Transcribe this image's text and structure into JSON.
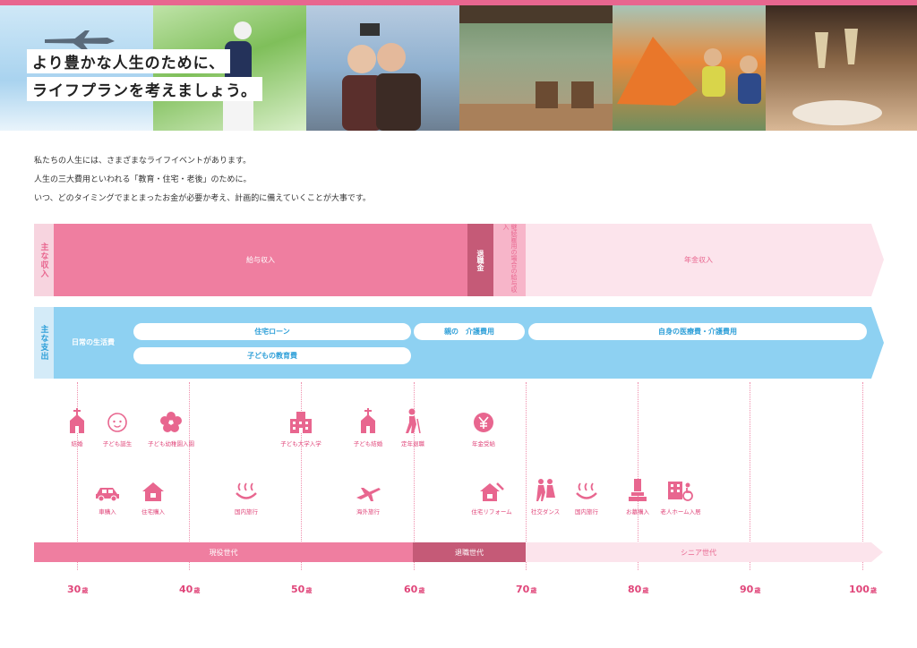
{
  "headline": {
    "line1": "より豊かな人生のために、",
    "line2": "ライフプランを考えましょう。"
  },
  "intro": [
    "私たちの人生には、さまざまなライフイベントがあります。",
    "人生の三大費用といわれる「教育・住宅・老後」のために。",
    "いつ、どのタイミングでまとまったお金が必要か考え、計画的に備えていくことが大事です。"
  ],
  "income": {
    "label": "主な収入",
    "salary": "給与収入",
    "retirement_pay": "退職金",
    "continued_employment": "継続雇用の場合の給与収入",
    "pension": "年金収入"
  },
  "expense": {
    "label": "主な支出",
    "daily": "日常の生活費",
    "housing_loan": "住宅ローン",
    "education": "子どもの教育費",
    "parents_care": "親の　介護費用",
    "own_medical": "自身の医療費・介護費用"
  },
  "events_top": [
    {
      "label": "結婚",
      "icon": "church-icon"
    },
    {
      "label": "子ども誕生",
      "icon": "baby-icon"
    },
    {
      "label": "子ども幼稚園入園",
      "icon": "flower-icon"
    },
    {
      "label": "子ども大学入学",
      "icon": "university-icon"
    },
    {
      "label": "子ども結婚",
      "icon": "church-icon"
    },
    {
      "label": "定年退職",
      "icon": "elder-icon"
    },
    {
      "label": "年金受給",
      "icon": "yen-icon"
    }
  ],
  "events_bottom": [
    {
      "label": "車購入",
      "icon": "car-icon"
    },
    {
      "label": "住宅購入",
      "icon": "house-icon"
    },
    {
      "label": "国内旅行",
      "icon": "hot-spring-icon"
    },
    {
      "label": "海外旅行",
      "icon": "airplane-icon"
    },
    {
      "label": "住宅リフォーム",
      "icon": "house-repair-icon"
    },
    {
      "label": "社交ダンス",
      "icon": "dance-icon"
    },
    {
      "label": "国内旅行",
      "icon": "hot-spring-icon"
    },
    {
      "label": "お墓購入",
      "icon": "grave-icon"
    },
    {
      "label": "老人ホーム入居",
      "icon": "nursing-home-icon"
    }
  ],
  "generations": {
    "working": "現役世代",
    "retired": "退職世代",
    "senior": "シニア世代"
  },
  "ages": [
    {
      "num": "30",
      "unit": "歳"
    },
    {
      "num": "40",
      "unit": "歳"
    },
    {
      "num": "50",
      "unit": "歳"
    },
    {
      "num": "60",
      "unit": "歳"
    },
    {
      "num": "70",
      "unit": "歳"
    },
    {
      "num": "80",
      "unit": "歳"
    },
    {
      "num": "90",
      "unit": "歳"
    },
    {
      "num": "100",
      "unit": "歳"
    }
  ],
  "colors": {
    "pink": "#ef7ea0",
    "pink_dark": "#c55a77",
    "pink_light": "#fce4ec",
    "blue": "#8ed1f2",
    "accent": "#e0467a"
  }
}
